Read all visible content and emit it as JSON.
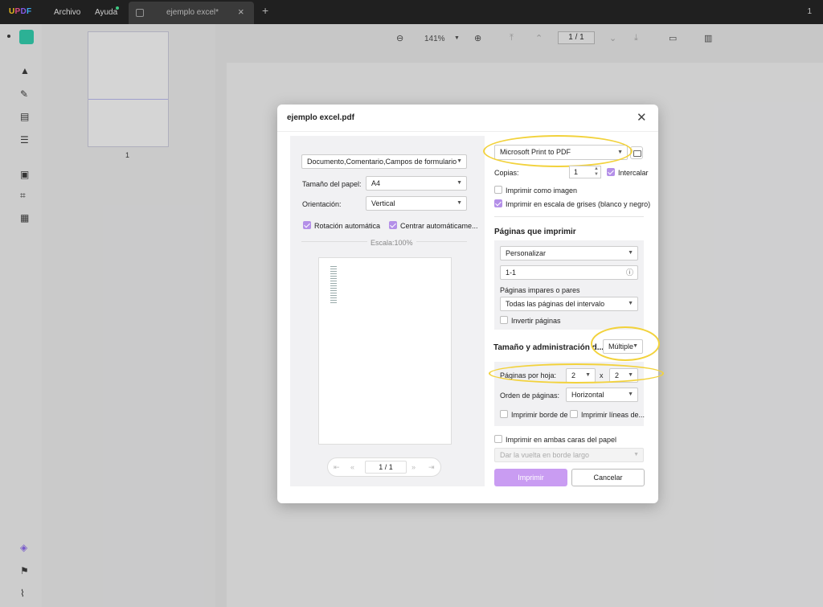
{
  "app": {
    "menu": [
      "Archivo",
      "Ayuda"
    ],
    "tab_title": "ejemplo excel*",
    "window_number": "1"
  },
  "viewer_toolbar": {
    "zoom": "141%",
    "page_indicator": "1 / 1"
  },
  "thumbnail": {
    "page_number": "1"
  },
  "dialog": {
    "title": "ejemplo excel.pdf",
    "left": {
      "content_select": "Documento,Comentario,Campos de formulario",
      "paper_size_label": "Tamaño del papel:",
      "paper_size_value": "A4",
      "orientation_label": "Orientación:",
      "orientation_value": "Vertical",
      "auto_rotate_label": "Rotación automática",
      "auto_center_label": "Centrar automáticame...",
      "scale_label": "Escala:100%",
      "pager_current": "1 / 1"
    },
    "right": {
      "printer": "Microsoft Print to PDF",
      "copies_label": "Copias:",
      "copies_value": "1",
      "collate_label": "Intercalar",
      "print_as_image_label": "Imprimir como imagen",
      "grayscale_label": "Imprimir en escala de grises (blanco y negro)",
      "pages_title": "Páginas que imprimir",
      "pages_mode": "Personalizar",
      "pages_range": "1-1",
      "odd_even_label": "Páginas impares o pares",
      "odd_even_value": "Todas las páginas del intervalo",
      "reverse_label": "Invertir páginas",
      "size_title": "Tamaño y administración d...",
      "size_mode": "Múltiple",
      "pages_per_sheet_label": "Páginas por hoja:",
      "pps_cols": "2",
      "pps_x": "x",
      "pps_rows": "2",
      "page_order_label": "Orden de páginas:",
      "page_order_value": "Horizontal",
      "print_border_label": "Imprimir borde de ...",
      "print_lines_label": "Imprimir líneas de...",
      "duplex_label": "Imprimir en ambas caras del papel",
      "flip_value": "Dar la vuelta en borde largo",
      "print_button": "Imprimir",
      "cancel_button": "Cancelar"
    }
  },
  "colors": {
    "accent": "#b48fe8",
    "highlight": "#f2d23c"
  }
}
